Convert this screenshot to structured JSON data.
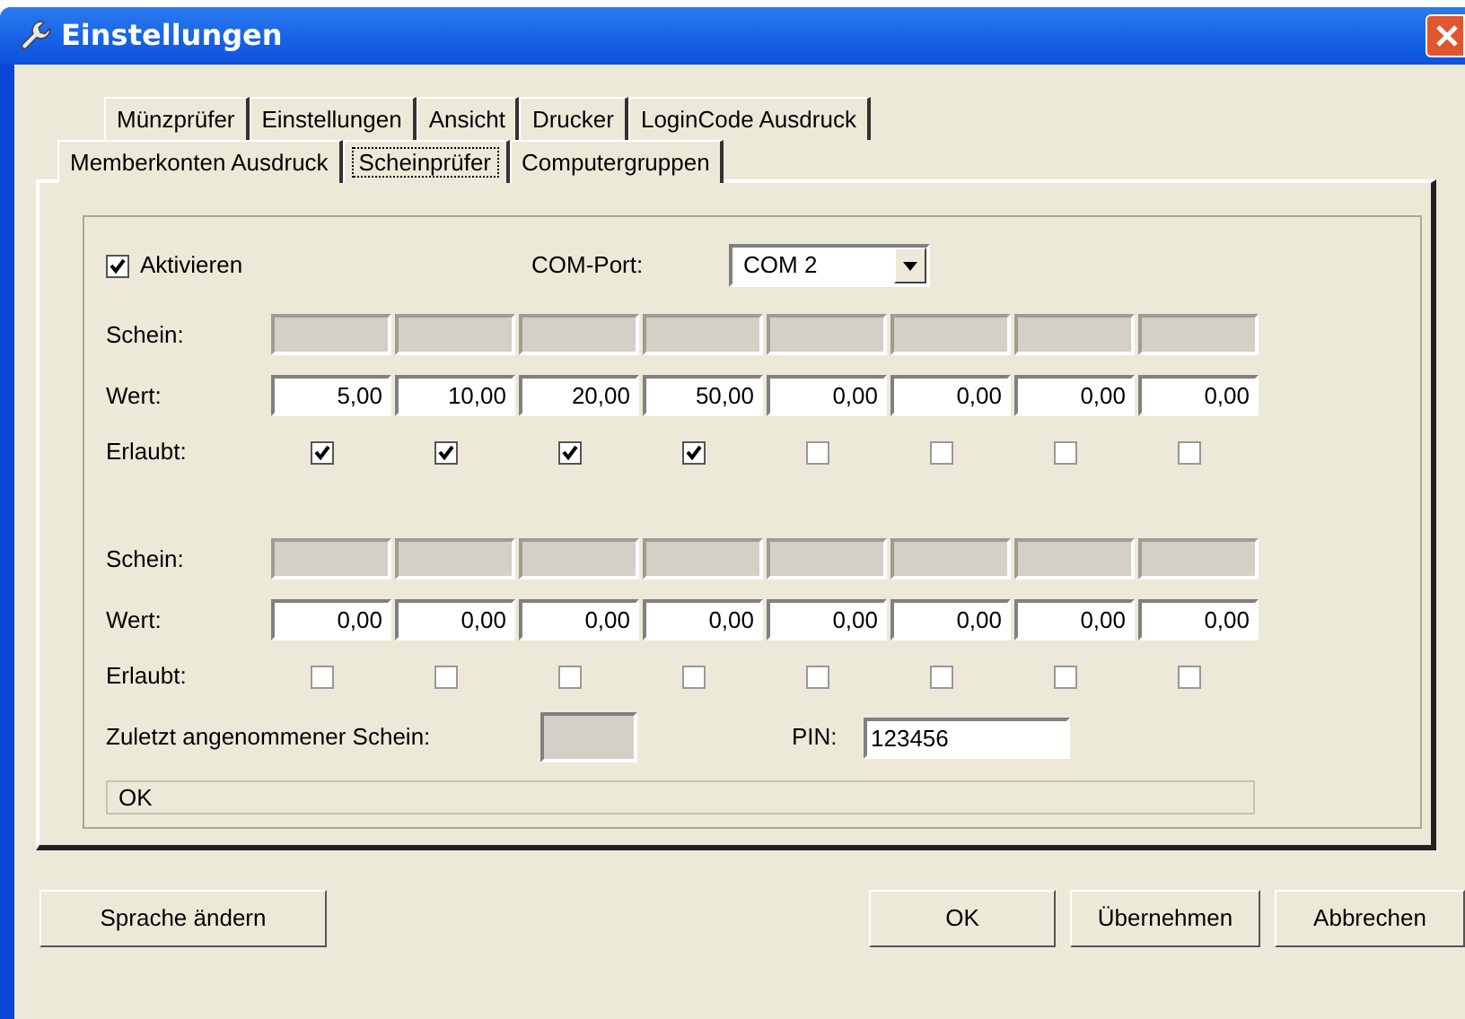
{
  "window": {
    "title": "Einstellungen"
  },
  "tabs_back": [
    {
      "label": "Münzprüfer",
      "selected": false
    },
    {
      "label": "Einstellungen",
      "selected": false
    },
    {
      "label": "Ansicht",
      "selected": false
    },
    {
      "label": "Drucker",
      "selected": false
    },
    {
      "label": "LoginCode Ausdruck",
      "selected": false
    }
  ],
  "tabs_front": [
    {
      "label": "Memberkonten Ausdruck",
      "selected": false
    },
    {
      "label": "Scheinprüfer",
      "selected": true
    },
    {
      "label": "Computergruppen",
      "selected": false
    }
  ],
  "activate": {
    "label": "Aktivieren",
    "checked": true
  },
  "com_port": {
    "label": "COM-Port:",
    "value": "COM 2"
  },
  "banks": [
    {
      "schein_label": "Schein:",
      "wert_label": "Wert:",
      "erlaubt_label": "Erlaubt:",
      "notes": [
        {
          "value": "5,00",
          "allowed": true
        },
        {
          "value": "10,00",
          "allowed": true
        },
        {
          "value": "20,00",
          "allowed": true
        },
        {
          "value": "50,00",
          "allowed": true
        },
        {
          "value": "0,00",
          "allowed": false
        },
        {
          "value": "0,00",
          "allowed": false
        },
        {
          "value": "0,00",
          "allowed": false
        },
        {
          "value": "0,00",
          "allowed": false
        }
      ]
    },
    {
      "schein_label": "Schein:",
      "wert_label": "Wert:",
      "erlaubt_label": "Erlaubt:",
      "notes": [
        {
          "value": "0,00",
          "allowed": false
        },
        {
          "value": "0,00",
          "allowed": false
        },
        {
          "value": "0,00",
          "allowed": false
        },
        {
          "value": "0,00",
          "allowed": false
        },
        {
          "value": "0,00",
          "allowed": false
        },
        {
          "value": "0,00",
          "allowed": false
        },
        {
          "value": "0,00",
          "allowed": false
        },
        {
          "value": "0,00",
          "allowed": false
        }
      ]
    }
  ],
  "last_accepted": {
    "label": "Zuletzt angenommener Schein:"
  },
  "pin": {
    "label": "PIN:",
    "value": "123456"
  },
  "status": "OK",
  "buttons": [
    {
      "label": "Sprache ändern",
      "kind": "left"
    },
    {
      "label": "OK",
      "kind": "right"
    },
    {
      "label": "Übernehmen",
      "kind": "right"
    },
    {
      "label": "Abbrechen",
      "kind": "right"
    }
  ]
}
